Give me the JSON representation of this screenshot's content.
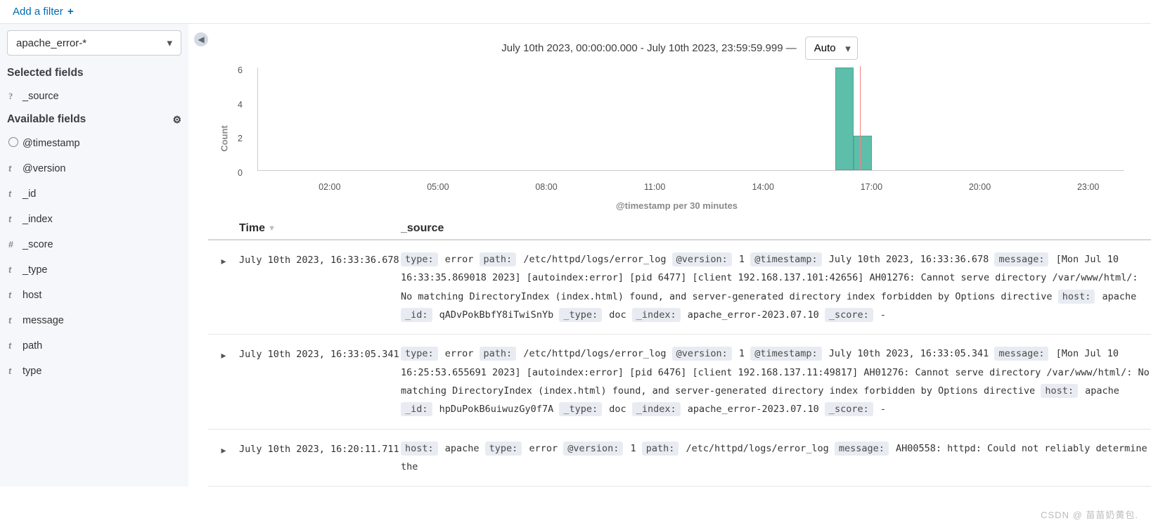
{
  "filter_bar": {
    "add_filter_label": "Add a filter"
  },
  "index_pattern": {
    "value": "apache_error-*"
  },
  "fields_panel": {
    "selected_title": "Selected fields",
    "available_title": "Available fields",
    "selected": [
      {
        "icon": "?",
        "name": "_source"
      }
    ],
    "available": [
      {
        "icon": "clock",
        "name": "@timestamp"
      },
      {
        "icon": "t",
        "name": "@version"
      },
      {
        "icon": "t",
        "name": "_id"
      },
      {
        "icon": "t",
        "name": "_index"
      },
      {
        "icon": "#",
        "name": "_score"
      },
      {
        "icon": "t",
        "name": "_type"
      },
      {
        "icon": "t",
        "name": "host"
      },
      {
        "icon": "t",
        "name": "message"
      },
      {
        "icon": "t",
        "name": "path"
      },
      {
        "icon": "t",
        "name": "type"
      }
    ]
  },
  "histogram": {
    "range_label": "July 10th 2023, 00:00:00.000 - July 10th 2023, 23:59:59.999 —",
    "interval_selected": "Auto",
    "yaxis_label": "Count",
    "xaxis_label": "@timestamp per 30 minutes"
  },
  "chart_data": {
    "type": "bar",
    "ylabel": "Count",
    "xlabel": "@timestamp per 30 minutes",
    "x_ticks": [
      "02:00",
      "05:00",
      "08:00",
      "11:00",
      "14:00",
      "17:00",
      "20:00",
      "23:00"
    ],
    "x_range_minutes": [
      0,
      1440
    ],
    "ylim": [
      0,
      6
    ],
    "y_ticks": [
      6,
      4,
      2,
      0
    ],
    "bars": [
      {
        "bucket_start": "16:00",
        "minute": 960,
        "value": 6
      },
      {
        "bucket_start": "16:30",
        "minute": 990,
        "value": 2
      }
    ],
    "marker_minute": 1000,
    "marker_color": "#F98080",
    "bar_color": "#5DBEAA"
  },
  "doc_table": {
    "columns": {
      "time": "Time",
      "source": "_source"
    },
    "rows": [
      {
        "time": "July 10th 2023, 16:33:36.678",
        "fields": {
          "type": "error",
          "path": "/etc/httpd/logs/error_log",
          "@version": "1",
          "@timestamp": "July 10th 2023, 16:33:36.678",
          "message": "[Mon Jul 10 16:33:35.869018 2023] [autoindex:error] [pid 6477] [client 192.168.137.101:42656] AH01276: Cannot serve directory /var/www/html/: No matching DirectoryIndex (index.html) found, and server-generated directory index forbidden by Options directive",
          "host": "apache",
          "_id": "qADvPokBbfY8iTwiSnYb",
          "_type": "doc",
          "_index": "apache_error-2023.07.10",
          "_score": "-"
        },
        "order": [
          "type",
          "path",
          "@version",
          "@timestamp",
          "message",
          "host",
          "_id",
          "_type",
          "_index",
          "_score"
        ]
      },
      {
        "time": "July 10th 2023, 16:33:05.341",
        "fields": {
          "type": "error",
          "path": "/etc/httpd/logs/error_log",
          "@version": "1",
          "@timestamp": "July 10th 2023, 16:33:05.341",
          "message": "[Mon Jul 10 16:25:53.655691 2023] [autoindex:error] [pid 6476] [client 192.168.137.11:49817] AH01276: Cannot serve directory /var/www/html/: No matching DirectoryIndex (index.html) found, and server-generated directory index forbidden by Options directive",
          "host": "apache",
          "_id": "hpDuPokB6uiwuzGy0f7A",
          "_type": "doc",
          "_index": "apache_error-2023.07.10",
          "_score": "-"
        },
        "order": [
          "type",
          "path",
          "@version",
          "@timestamp",
          "message",
          "host",
          "_id",
          "_type",
          "_index",
          "_score"
        ]
      },
      {
        "time": "July 10th 2023, 16:20:11.711",
        "fields": {
          "host": "apache",
          "type": "error",
          "@version": "1",
          "path": "/etc/httpd/logs/error_log",
          "message": "AH00558: httpd: Could not reliably determine the"
        },
        "order": [
          "host",
          "type",
          "@version",
          "path",
          "message"
        ]
      }
    ]
  },
  "watermark": "CSDN @ 苗苗奶黄包."
}
